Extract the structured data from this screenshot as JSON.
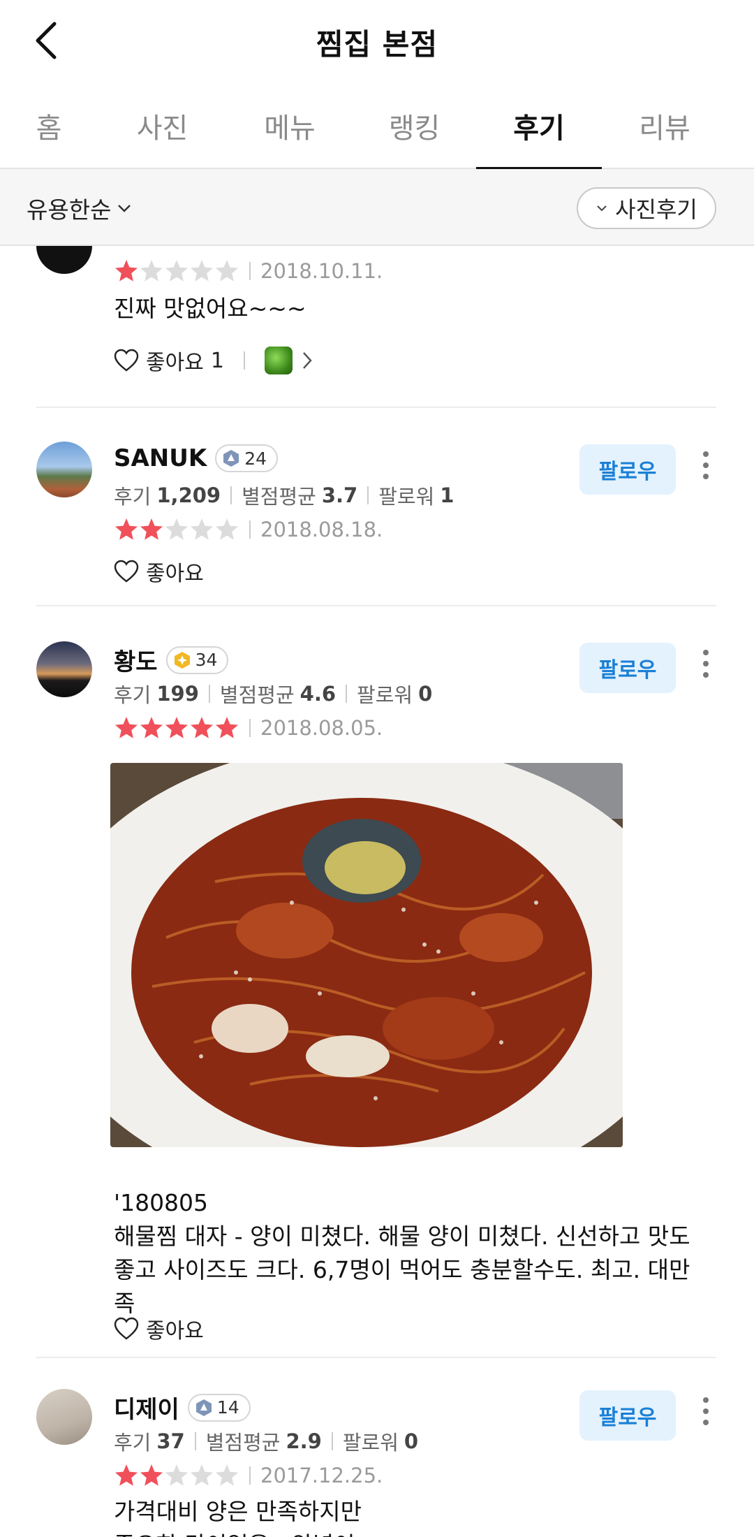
{
  "header": {
    "title": "찜집 본점"
  },
  "tabs": [
    {
      "label": "홈",
      "active": false
    },
    {
      "label": "사진",
      "active": false
    },
    {
      "label": "메뉴",
      "active": false
    },
    {
      "label": "랭킹",
      "active": false
    },
    {
      "label": "후기",
      "active": true
    },
    {
      "label": "리뷰",
      "active": false
    }
  ],
  "filter": {
    "sort_label": "유용한순",
    "photo_filter_label": "사진후기"
  },
  "colors": {
    "star_filled": "#f0505a",
    "star_empty": "#dcdcdc",
    "follow_bg": "#e3f2fd",
    "follow_text": "#1a7fd6"
  },
  "reviews": [
    {
      "rating": 1,
      "rating_max": 5,
      "date": "2018.10.11.",
      "text": "진짜 맛없어요~~~",
      "like_label": "좋아요",
      "like_count": "1"
    },
    {
      "user": "SANUK",
      "level": "24",
      "stats": {
        "review_label": "후기",
        "review_count": "1,209",
        "avg_label": "별점평균",
        "avg": "3.7",
        "follower_label": "팔로워",
        "followers": "1"
      },
      "follow_label": "팔로우",
      "rating": 2,
      "rating_max": 5,
      "date": "2018.08.18.",
      "like_label": "좋아요"
    },
    {
      "user": "황도",
      "level": "34",
      "stats": {
        "review_label": "후기",
        "review_count": "199",
        "avg_label": "별점평균",
        "avg": "4.6",
        "follower_label": "팔로워",
        "followers": "0"
      },
      "follow_label": "팔로우",
      "rating": 5,
      "rating_max": 5,
      "date": "2018.08.05.",
      "text_line1": "'180805",
      "text_body": "해물찜 대자 - 양이 미쳤다. 해물 양이 미쳤다. 신선하고 맛도 좋고 사이즈도 크다. 6,7명이 먹어도 충분할수도. 최고. 대만족",
      "like_label": "좋아요"
    },
    {
      "user": "디제이",
      "level": "14",
      "stats": {
        "review_label": "후기",
        "review_count": "37",
        "avg_label": "별점평균",
        "avg": "2.9",
        "follower_label": "팔로워",
        "followers": "0"
      },
      "follow_label": "팔로우",
      "rating": 2,
      "rating_max": 5,
      "date": "2017.12.25.",
      "text": "가격대비 양은 만족하지만",
      "text_cut": "중요한 맛이없음.. 양념이"
    }
  ]
}
